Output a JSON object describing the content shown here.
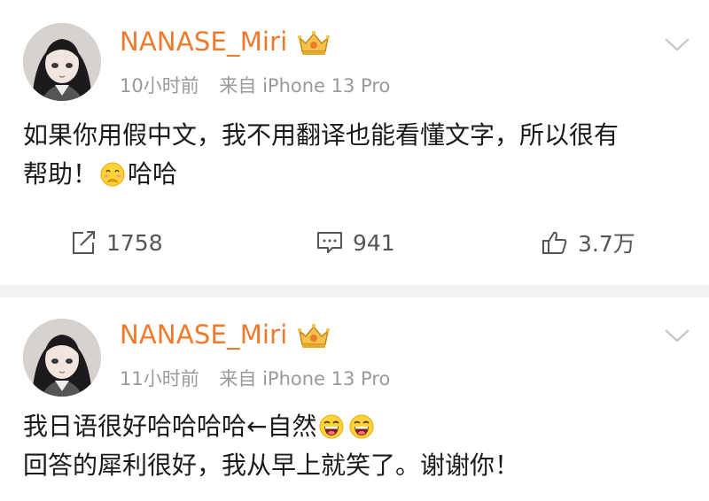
{
  "posts": [
    {
      "username": "NANASE_Miri",
      "time": "10小时前",
      "source": "来自 iPhone 13 Pro",
      "lines": [
        "如果你用假中文，我不用翻译也能看懂文字，所以很有",
        "帮助！",
        "哈哈"
      ],
      "emoji": [
        "shy-giggle-emoji"
      ],
      "actions": {
        "repost_count": "1758",
        "comment_count": "941",
        "like_count": "3.7万"
      }
    },
    {
      "username": "NANASE_Miri",
      "time": "11小时前",
      "source": "来自 iPhone 13 Pro",
      "lines": [
        "我日语很好哈哈哈哈←自然",
        "回答的犀利很好，我从早上就笑了。谢谢你！"
      ],
      "emoji": [
        "laughing-emoji",
        "laughing-emoji"
      ]
    }
  ],
  "colors": {
    "username": "#f07a2c",
    "meta": "#9a9a9a",
    "divider": "#f2f2f2",
    "icon": "#555555"
  }
}
